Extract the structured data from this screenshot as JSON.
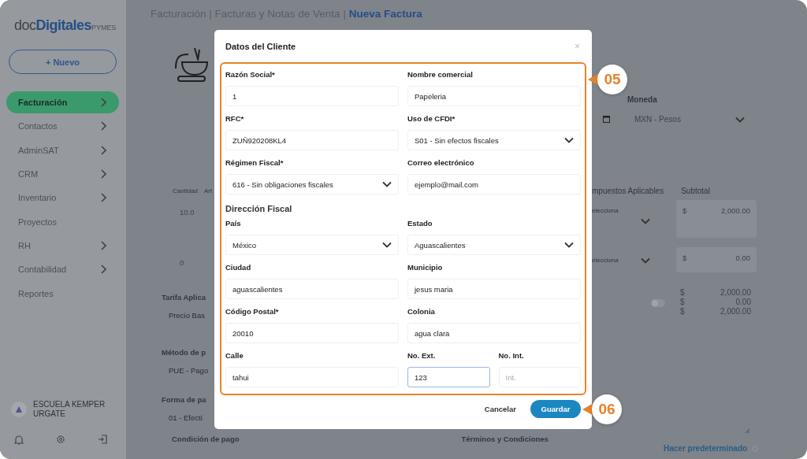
{
  "sidebar": {
    "logo": {
      "light": "doc",
      "bold": "Digitales",
      "suffix": "PYMES"
    },
    "new_button": "+ Nuevo",
    "items": [
      {
        "label": "Facturación",
        "selected": true,
        "has_submenu": true
      },
      {
        "label": "Contactos",
        "selected": false,
        "has_submenu": true
      },
      {
        "label": "AdminSAT",
        "selected": false,
        "has_submenu": true
      },
      {
        "label": "CRM",
        "selected": false,
        "has_submenu": true
      },
      {
        "label": "Inventario",
        "selected": false,
        "has_submenu": true
      },
      {
        "label": "Proyectos",
        "selected": false,
        "has_submenu": false
      },
      {
        "label": "RH",
        "selected": false,
        "has_submenu": true
      },
      {
        "label": "Contabilidad",
        "selected": false,
        "has_submenu": true
      },
      {
        "label": "Reportes",
        "selected": false,
        "has_submenu": false
      }
    ],
    "account": "ESCUELA KEMPER URGATE"
  },
  "breadcrumb": {
    "path": "Facturación | Facturas y Notas de Venta |",
    "current": "Nueva Factura"
  },
  "invoice": {
    "currency_label": "Moneda",
    "currency_value": "MXN - Pesos",
    "columns_left": [
      "Cantidad",
      "Art"
    ],
    "columns_right": [
      "mpuestos Aplicables",
      "Subtotal"
    ],
    "lines": [
      {
        "quantity": "10.0",
        "tax": "elecciona",
        "currency": "$",
        "subtotal": "2,000.00"
      },
      {
        "quantity": "0",
        "tax": "elecciona",
        "currency": "$",
        "subtotal": "0.00"
      }
    ],
    "fields_left": [
      {
        "label": "Tarifa Aplica",
        "value": "Precio Bas"
      },
      {
        "label": "Método de p",
        "value": "PUE - Pago"
      },
      {
        "label": "Forma de pa",
        "value": "01 - Efecti"
      }
    ],
    "condition_label": "Condición de pago",
    "toggle_on": false,
    "totals": [
      {
        "currency": "$",
        "amount": "2,000.00"
      },
      {
        "currency": "$",
        "amount": "0.00"
      },
      {
        "currency": "$",
        "amount": "2,000.00"
      }
    ],
    "terms_label": "Términos y Condiciones",
    "default_link": "Hacer predeterminado"
  },
  "modal": {
    "title": "Datos del Cliente",
    "close": "×",
    "sections": [
      {
        "fields": [
          {
            "label": "Razón Social*",
            "kind": "text",
            "value": "1",
            "focused": false
          },
          {
            "label": "Nombre comercial",
            "kind": "text",
            "value": "Papeleria",
            "focused": false
          },
          {
            "label": "RFC*",
            "kind": "text",
            "value": "ZUÑ920208KL4",
            "focused": false
          },
          {
            "label": "Uso de CFDI*",
            "kind": "select",
            "value": "S01 - Sin efectos fiscales",
            "focused": false
          },
          {
            "label": "Régimen Fiscal*",
            "kind": "select",
            "value": "616 - Sin obligaciones fiscales",
            "focused": false
          },
          {
            "label": "Correo electrónico",
            "kind": "text",
            "value": "ejemplo@mail.com",
            "focused": false
          }
        ]
      },
      {
        "heading": "Dirección Fiscal",
        "fields": [
          {
            "label": "País",
            "kind": "select",
            "value": "México",
            "focused": false
          },
          {
            "label": "Estado",
            "kind": "select",
            "value": "Aguascalientes",
            "focused": false
          },
          {
            "label": "Ciudad",
            "kind": "text",
            "value": "aguascalientes",
            "focused": false
          },
          {
            "label": "Municipio",
            "kind": "text",
            "value": "jesus maria",
            "focused": false
          },
          {
            "label": "Código Postal*",
            "kind": "text",
            "value": "20010",
            "focused": false
          },
          {
            "label": "Colonia",
            "kind": "text",
            "value": "agua clara",
            "focused": false
          },
          {
            "label": "Calle",
            "kind": "text",
            "value": "tahui",
            "focused": false
          },
          {
            "label": "No. Ext.",
            "kind": "short",
            "value": "123",
            "focused": true
          },
          {
            "label": "No. Int.",
            "kind": "short",
            "placeholder": "Int.",
            "focused": false
          }
        ]
      }
    ],
    "cancel": "Cancelar",
    "save": "Guardar"
  },
  "callouts": [
    "05",
    "06"
  ]
}
